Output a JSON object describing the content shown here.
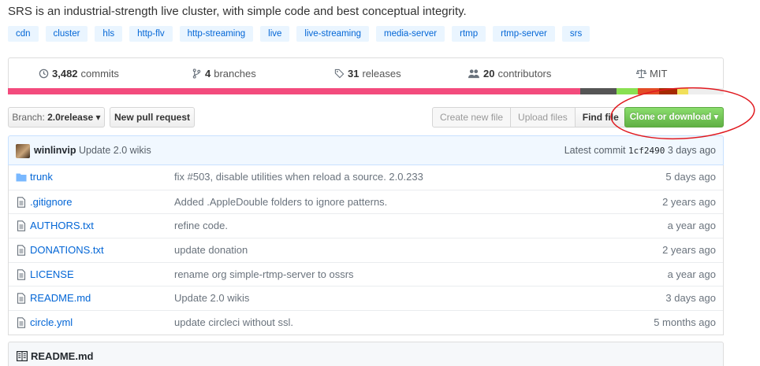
{
  "repo": {
    "description": "SRS is an industrial-strength live cluster, with simple code and best conceptual integrity.",
    "topics": [
      "cdn",
      "cluster",
      "hls",
      "http-flv",
      "http-streaming",
      "live",
      "live-streaming",
      "media-server",
      "rtmp",
      "rtmp-server",
      "srs"
    ]
  },
  "summary": {
    "commits_count": "3,482",
    "commits_label": "commits",
    "branches_count": "4",
    "branches_label": "branches",
    "releases_count": "31",
    "releases_label": "releases",
    "contributors_count": "20",
    "contributors_label": "contributors",
    "license": "MIT"
  },
  "language_bar": [
    {
      "color": "#f34b7d",
      "fraction": 0.8
    },
    {
      "color": "#555555",
      "fraction": 0.05
    },
    {
      "color": "#89e051",
      "fraction": 0.03
    },
    {
      "color": "#e34c26",
      "fraction": 0.03
    },
    {
      "color": "#a52a00",
      "fraction": 0.025
    },
    {
      "color": "#f1e05a",
      "fraction": 0.015
    },
    {
      "color": "#eeeeee",
      "fraction": 0.05
    }
  ],
  "toolbar": {
    "branch_prefix": "Branch:",
    "branch_name": "2.0release",
    "new_pull_request": "New pull request",
    "create_new_file": "Create new file",
    "upload_files": "Upload files",
    "find_file": "Find file",
    "clone_or_download": "Clone or download"
  },
  "latest_commit": {
    "author": "winlinvip",
    "message": "Update 2.0 wikis",
    "prefix": "Latest commit",
    "sha": "1cf2490",
    "age": "3 days ago"
  },
  "files": [
    {
      "type": "dir",
      "name": "trunk",
      "message": "fix #503, disable utilities when reload a source. 2.0.233",
      "age": "5 days ago"
    },
    {
      "type": "file",
      "name": ".gitignore",
      "message": "Added .AppleDouble folders to ignore patterns.",
      "age": "2 years ago"
    },
    {
      "type": "file",
      "name": "AUTHORS.txt",
      "message": "refine code.",
      "age": "a year ago"
    },
    {
      "type": "file",
      "name": "DONATIONS.txt",
      "message": "update donation",
      "age": "2 years ago"
    },
    {
      "type": "file",
      "name": "LICENSE",
      "message": "rename org simple-rtmp-server to ossrs",
      "age": "a year ago"
    },
    {
      "type": "file",
      "name": "README.md",
      "message": "Update 2.0 wikis",
      "age": "3 days ago"
    },
    {
      "type": "file",
      "name": "circle.yml",
      "message": "update circleci without ssl.",
      "age": "5 months ago"
    }
  ],
  "readme": {
    "title": "README.md"
  },
  "colors": {
    "link": "#0366d6",
    "clone_green": "#60b044",
    "annotation_red": "#e0191f"
  }
}
